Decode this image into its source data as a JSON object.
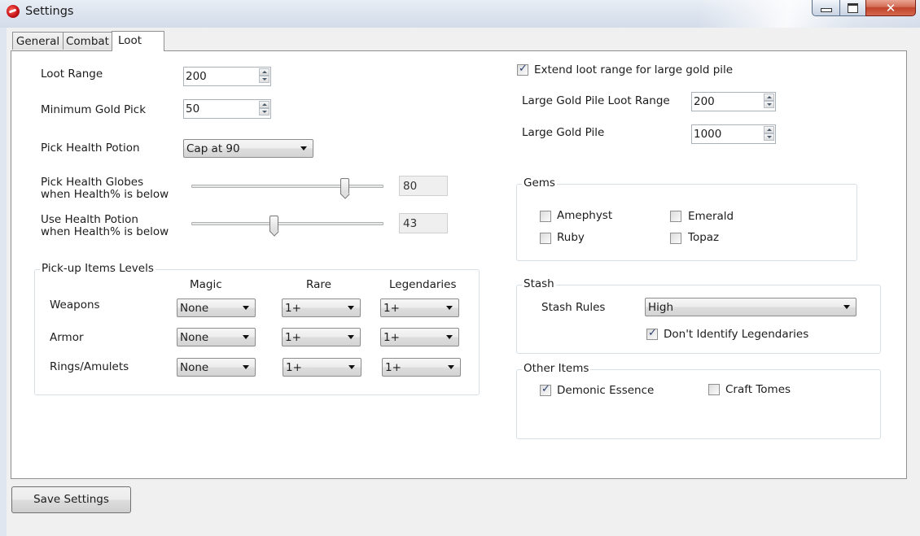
{
  "window": {
    "title": "Settings"
  },
  "tabs": [
    "General",
    "Combat",
    "Loot"
  ],
  "loot": {
    "loot_range": {
      "label": "Loot Range",
      "value": "200"
    },
    "min_gold_pick": {
      "label": "Minimum Gold Pick",
      "value": "50"
    },
    "pick_health_potion": {
      "label": "Pick Health Potion",
      "value": "Cap at 90"
    },
    "pick_health_globes": {
      "label1": "Pick Health Globes",
      "label2": "when Health% is below",
      "value": "80",
      "level": 80
    },
    "use_health_potion": {
      "label1": "Use Health Potion",
      "label2": "when Health% is below",
      "value": "43",
      "level": 43
    }
  },
  "pickup": {
    "title": "Pick-up Items Levels",
    "columns": [
      "Magic",
      "Rare",
      "Legendaries"
    ],
    "rows": [
      {
        "label": "Weapons",
        "values": [
          "None",
          "1+",
          "1+"
        ]
      },
      {
        "label": "Armor",
        "values": [
          "None",
          "1+",
          "1+"
        ]
      },
      {
        "label": "Rings/Amulets",
        "values": [
          "None",
          "1+",
          "1+"
        ]
      }
    ]
  },
  "gold": {
    "extend_label": "Extend loot range for large gold pile",
    "extend_checked": true,
    "range_label": "Large Gold Pile Loot Range",
    "range_value": "200",
    "pile_label": "Large Gold Pile",
    "pile_value": "1000"
  },
  "gems": {
    "title": "Gems",
    "items": [
      {
        "label": "Amephyst",
        "checked": false
      },
      {
        "label": "Emerald",
        "checked": false
      },
      {
        "label": "Ruby",
        "checked": false
      },
      {
        "label": "Topaz",
        "checked": false
      }
    ]
  },
  "stash": {
    "title": "Stash",
    "rules_label": "Stash Rules",
    "rules_value": "High",
    "dont_identify_label": "Don't Identify Legendaries",
    "dont_identify_checked": true
  },
  "other": {
    "title": "Other Items",
    "items": [
      {
        "label": "Demonic Essence",
        "checked": true
      },
      {
        "label": "Craft Tomes",
        "checked": false
      }
    ]
  },
  "save_button": "Save Settings"
}
